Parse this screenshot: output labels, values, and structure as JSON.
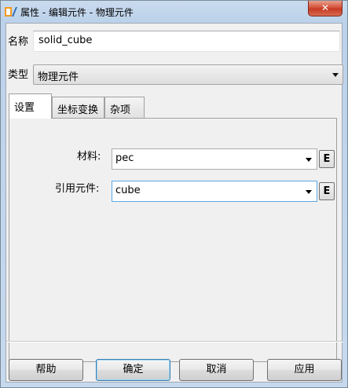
{
  "window": {
    "title": "属性 - 编辑元件 - 物理元件",
    "close_label": "✕"
  },
  "form": {
    "name_label": "名称",
    "name_value": "solid_cube",
    "type_label": "类型",
    "type_value": "物理元件"
  },
  "tabs": [
    {
      "label": "设置",
      "active": true
    },
    {
      "label": "坐标变换",
      "active": false
    },
    {
      "label": "杂项",
      "active": false
    }
  ],
  "settings": {
    "material_label": "材料:",
    "material_value": "pec",
    "ref_label": "引用元件:",
    "ref_value": "cube",
    "e_label": "E"
  },
  "buttons": {
    "help": "帮助",
    "ok": "确定",
    "cancel": "取消",
    "apply": "应用"
  },
  "colors": {
    "icon_orange": "#f29a1f",
    "icon_blue": "#2b6cb0",
    "close_red": "#c63a22"
  },
  "icons": {
    "app": "app-logo-icon",
    "close": "close-icon",
    "dropdown": "chevron-down-icon"
  }
}
